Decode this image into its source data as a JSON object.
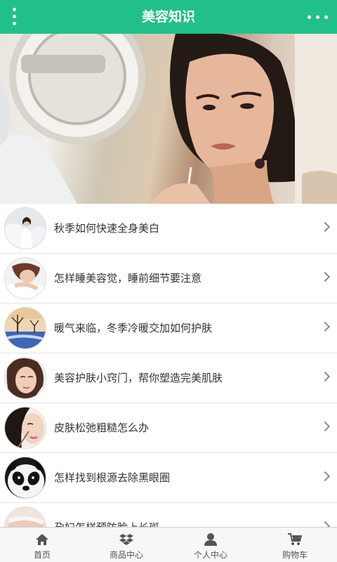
{
  "header": {
    "title": "美容知识",
    "background": "#21c08b"
  },
  "banner": {
    "image": "woman-beauty-banner"
  },
  "articles": [
    {
      "title": "秋季如何快速全身美白",
      "thumb": "woman-white-dress-thumb"
    },
    {
      "title": "怎样睡美容觉，睡前细节要注意",
      "thumb": "sleeping-woman-thumb"
    },
    {
      "title": "暖气来临，冬季冷暖交加如何护肤",
      "thumb": "winter-tree-thumb"
    },
    {
      "title": "美容护肤小窍门，帮你塑造完美肌肤",
      "thumb": "woman-face-thumb"
    },
    {
      "title": "皮肤松弛粗糙怎么办",
      "thumb": "woman-makeup-thumb"
    },
    {
      "title": "怎样找到根源去除黑眼圈",
      "thumb": "panda-thumb"
    },
    {
      "title": "孕妇怎样预防脸上长斑",
      "thumb": "pregnant-belly-thumb"
    }
  ],
  "tabbar": {
    "tabs": [
      {
        "label": "首页",
        "icon": "home-icon"
      },
      {
        "label": "商品中心",
        "icon": "dropbox-icon"
      },
      {
        "label": "个人中心",
        "icon": "user-icon"
      },
      {
        "label": "购物车",
        "icon": "cart-icon"
      }
    ]
  }
}
